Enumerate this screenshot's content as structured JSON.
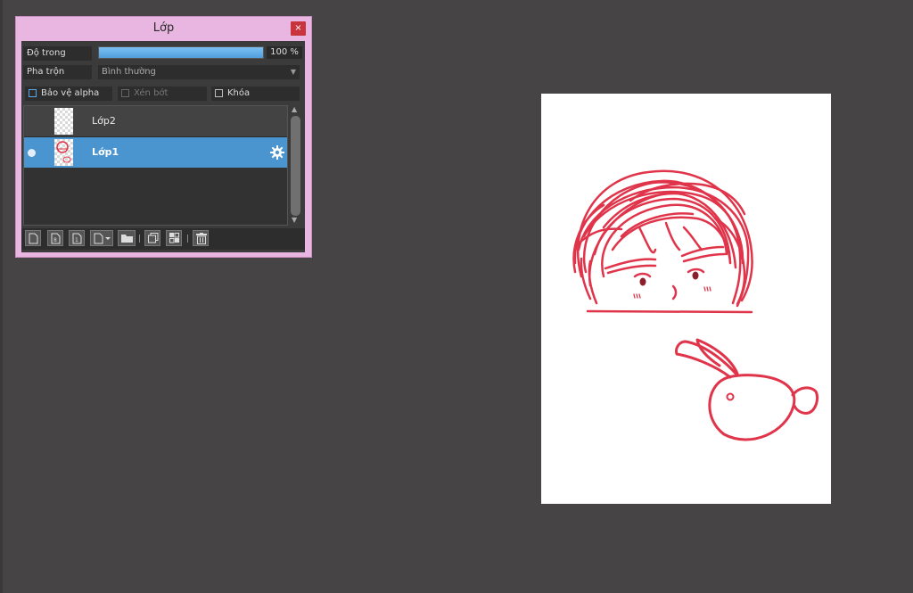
{
  "panel": {
    "title": "Lớp",
    "close_glyph": "×",
    "opacity_label": "Độ trong",
    "opacity_value": "100 %",
    "opacity_fraction": 1.0,
    "blend_label": "Pha trộn",
    "blend_value": "Bình thường",
    "checkboxes": {
      "alpha": "Bảo vệ alpha",
      "clip": "Xén bớt",
      "lock": "Khóa"
    },
    "layers": [
      {
        "name": "Lớp2",
        "selected": false,
        "visible_icon": false
      },
      {
        "name": "Lớp1",
        "selected": true,
        "visible_icon": true
      }
    ],
    "toolbar": [
      {
        "icon": "new-layer-icon"
      },
      {
        "icon": "new-layer-8bit-icon"
      },
      {
        "icon": "new-layer-1bit-icon"
      },
      {
        "icon": "add-special-layer-icon"
      },
      {
        "icon": "folder-icon"
      },
      {
        "icon": "duplicate-layer-icon"
      },
      {
        "icon": "merge-layer-icon"
      },
      {
        "icon": "delete-layer-icon"
      }
    ]
  },
  "colors": {
    "background": "#464444",
    "panel_frame": "#e8b6e1",
    "selection": "#4a95d0",
    "stroke": "#e0344a",
    "close_button": "#c8333d"
  }
}
